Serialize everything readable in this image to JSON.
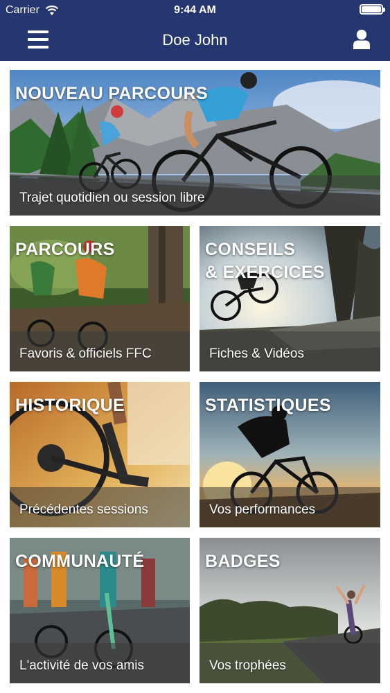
{
  "status_bar": {
    "carrier": "Carrier",
    "time": "9:44 AM"
  },
  "nav": {
    "title": "Doe John"
  },
  "tiles": [
    {
      "title": "NOUVEAU PARCOURS",
      "subtitle": "Trajet quotidien ou session libre",
      "image": "road-cyclists-mountains"
    },
    {
      "title": "PARCOURS",
      "subtitle": "Favoris & officiels FFC",
      "image": "mountain-bikers-forest"
    },
    {
      "title": "CONSEILS\n& EXERCICES",
      "subtitle": "Fiches & Vidéos",
      "image": "bmx-jump-sunset"
    },
    {
      "title": "HISTORIQUE",
      "subtitle": "Précédentes sessions",
      "image": "bike-pedals-autumn"
    },
    {
      "title": "STATISTIQUES",
      "subtitle": "Vos performances",
      "image": "cyclist-silhouette-sunset"
    },
    {
      "title": "COMMUNAUTÉ",
      "subtitle": "L'activité de vos amis",
      "image": "peloton-race"
    },
    {
      "title": "BADGES",
      "subtitle": "Vos trophées",
      "image": "cyclist-arms-raised"
    }
  ],
  "colors": {
    "nav_bg": "#253670",
    "band": "rgba(60,60,60,0.55)"
  }
}
